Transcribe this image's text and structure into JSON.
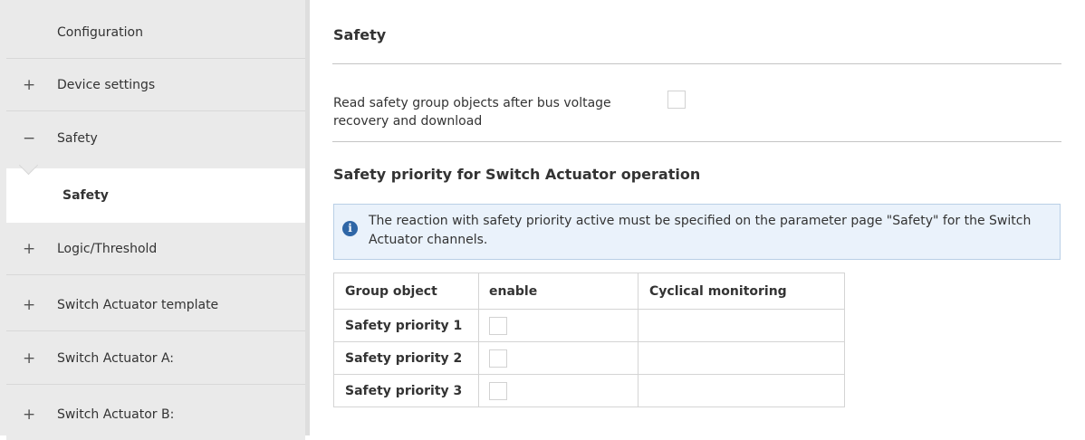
{
  "sidebar": {
    "items": [
      {
        "prefix": "",
        "label": "Configuration"
      },
      {
        "prefix": "+",
        "label": "Device settings"
      },
      {
        "prefix": "−",
        "label": "Safety"
      },
      {
        "prefix": "",
        "label": "Safety"
      },
      {
        "prefix": "+",
        "label": "Logic/Threshold"
      },
      {
        "prefix": "+",
        "label": "Switch Actuator template"
      },
      {
        "prefix": "+",
        "label": "Switch Actuator A:"
      },
      {
        "prefix": "+",
        "label": "Switch Actuator B:"
      }
    ]
  },
  "main": {
    "title": "Safety",
    "read_param": {
      "label": "Read safety group objects after bus voltage recovery and download",
      "checked": false
    },
    "section_title": "Safety priority for Switch Actuator operation",
    "info": {
      "icon": "info-icon",
      "text": "The reaction with safety priority active must be specified on the parameter page \"Safety\" for the Switch Actuator channels."
    },
    "table": {
      "headers": [
        "Group object",
        "enable",
        "Cyclical monitoring"
      ],
      "rows": [
        {
          "name": "Safety priority 1",
          "enable": false,
          "cyclical": ""
        },
        {
          "name": "Safety priority 2",
          "enable": false,
          "cyclical": ""
        },
        {
          "name": "Safety priority 3",
          "enable": false,
          "cyclical": ""
        }
      ]
    }
  },
  "colors": {
    "sidebar_bg": "#eaeaea",
    "info_bg": "#eaf2fb",
    "info_icon": "#2f66a6"
  }
}
